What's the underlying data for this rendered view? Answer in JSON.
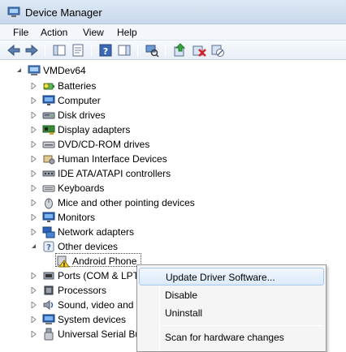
{
  "window": {
    "title": "Device Manager"
  },
  "menu": [
    {
      "label": "File"
    },
    {
      "label": "Action"
    },
    {
      "label": "View"
    },
    {
      "label": "Help"
    }
  ],
  "toolbar": {
    "buttons": [
      {
        "icon": "back-arrow-icon"
      },
      {
        "icon": "forward-arrow-icon"
      },
      {
        "icon": "show-hide-console-tree-icon"
      },
      {
        "icon": "properties-icon"
      },
      {
        "icon": "help-icon"
      },
      {
        "icon": "action-pane-icon"
      },
      {
        "icon": "scan-hardware-icon"
      },
      {
        "icon": "update-driver-icon"
      },
      {
        "icon": "uninstall-icon"
      },
      {
        "icon": "disable-icon"
      }
    ]
  },
  "tree": {
    "root": {
      "label": "VMDev64",
      "icon": "computer-icon"
    },
    "categories": [
      {
        "label": "Batteries",
        "icon": "battery-icon"
      },
      {
        "label": "Computer",
        "icon": "monitor-icon"
      },
      {
        "label": "Disk drives",
        "icon": "disk-drive-icon"
      },
      {
        "label": "Display adapters",
        "icon": "display-adapter-icon"
      },
      {
        "label": "DVD/CD-ROM drives",
        "icon": "dvd-drive-icon"
      },
      {
        "label": "Human Interface Devices",
        "icon": "hid-icon"
      },
      {
        "label": "IDE ATA/ATAPI controllers",
        "icon": "ide-controller-icon"
      },
      {
        "label": "Keyboards",
        "icon": "keyboard-icon"
      },
      {
        "label": "Mice and other pointing devices",
        "icon": "mouse-icon"
      },
      {
        "label": "Monitors",
        "icon": "monitor-icon"
      },
      {
        "label": "Network adapters",
        "icon": "network-adapter-icon"
      },
      {
        "label": "Other devices",
        "icon": "unknown-device-icon",
        "expanded": true
      },
      {
        "label": "Android Phone",
        "icon": "warning-device-icon",
        "child": true,
        "selected": true
      },
      {
        "label": "Ports (COM & LPT",
        "icon": "port-icon"
      },
      {
        "label": "Processors",
        "icon": "processor-icon"
      },
      {
        "label": "Sound, video and",
        "icon": "sound-icon"
      },
      {
        "label": "System devices",
        "icon": "system-device-icon"
      },
      {
        "label": "Universal Serial Bus",
        "icon": "usb-icon"
      }
    ]
  },
  "context_menu": {
    "items": [
      {
        "label": "Update Driver Software...",
        "highlighted": true
      },
      {
        "label": "Disable"
      },
      {
        "label": "Uninstall"
      },
      {
        "label": "Scan for hardware changes"
      }
    ]
  }
}
